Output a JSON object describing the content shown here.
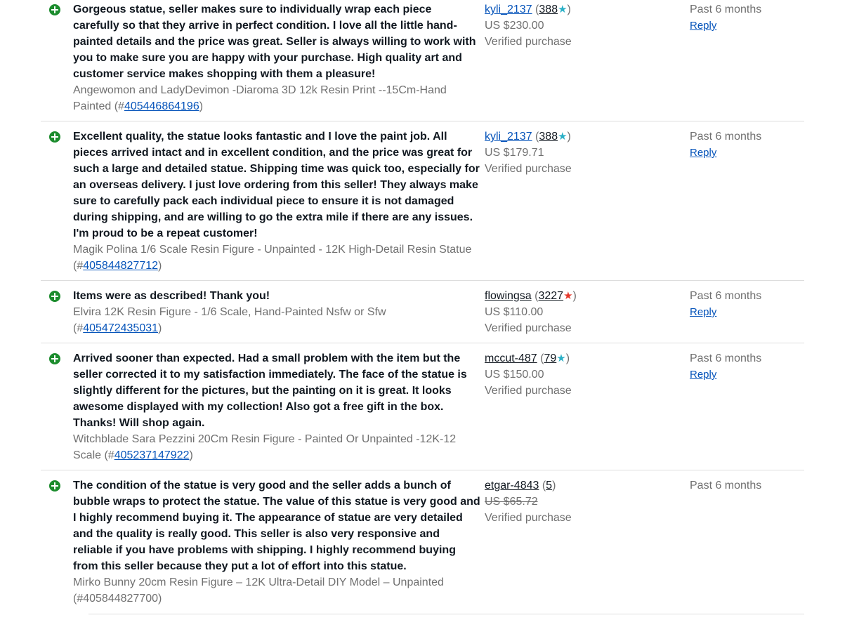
{
  "feedback": [
    {
      "comment": "Gorgeous statue, seller makes sure to individually wrap each piece carefully so that they arrive in perfect condition. I love all the little hand-painted details and the price was great. Seller is always willing to work with you to make sure you are happy with your purchase. High quality art and customer service makes shopping with them a pleasure!",
      "item_title": "Angewomon and LadyDevimon -Diaroma 3D 12k Resin Print --15Cm-Hand Painted",
      "item_id": "405446864196",
      "buyer": "kyli_2137",
      "score": "388",
      "star": "teal",
      "price": "US $230.00",
      "verified": "Verified purchase",
      "time": "Past 6 months",
      "reply": "Reply"
    },
    {
      "comment": "Excellent quality, the statue looks fantastic and I love the paint job. All pieces arrived intact and in excellent condition, and the price was great for such a large and detailed statue. Shipping time was quick too, especially for an overseas delivery. I just love ordering from this seller! They always make sure to carefully pack each individual piece to ensure it is not damaged during shipping, and are willing to go the extra mile if there are any issues. I'm proud to be a repeat customer!",
      "item_title": "Magik Polina 1/6 Scale Resin Figure - Unpainted - 12K High-Detail Resin Statue",
      "item_id": "405844827712",
      "buyer": "kyli_2137",
      "score": "388",
      "star": "teal",
      "price": "US $179.71",
      "verified": "Verified purchase",
      "time": "Past 6 months",
      "reply": "Reply"
    },
    {
      "comment": "Items were as described! Thank you!",
      "item_title": "Elvira 12K Resin Figure - 1/6 Scale, Hand-Painted Nsfw or Sfw",
      "item_id": "405472435031",
      "buyer": "flowingsa",
      "score": "3227",
      "star": "red",
      "price": "US $110.00",
      "verified": "Verified purchase",
      "time": "Past 6 months",
      "reply": "Reply"
    },
    {
      "comment": "Arrived sooner than expected. Had a small problem with the item but the seller corrected it to my satisfaction immediately. The face of the statue is slightly different for the pictures, but the painting on it is great. It looks awesome displayed with my collection! Also got a free gift in the box. Thanks! Will shop again.",
      "item_title": "Witchblade Sara Pezzini 20Cm Resin Figure - Painted Or Unpainted -12K-12 Scale",
      "item_id": "405237147922",
      "buyer": "mccut-487",
      "score": "79",
      "star": "teal",
      "price": "US $150.00",
      "verified": "Verified purchase",
      "time": "Past 6 months",
      "reply": "Reply"
    },
    {
      "comment": "The condition of the statue is very good and the seller adds a bunch of bubble wraps to protect the statue. The value of this statue is very good and I highly recommend buying it. The appearance of statue are very detailed and the quality is really good. This seller is also very responsive and reliable if you have problems with shipping. I highly recommend buying from this seller because they put a lot of effort into this statue.",
      "item_title": "Mirko Bunny 20cm Resin Figure – 12K Ultra-Detail DIY Model – Unpainted",
      "item_id": "405844827700",
      "buyer": "etgar-4843",
      "score": "5",
      "star": "",
      "price": "US $65.72",
      "verified": "Verified purchase",
      "time": "Past 6 months",
      "reply": ""
    }
  ],
  "colors": {
    "positive_icon": "#1b8c2d",
    "link": "#0654ba",
    "star_teal": "#2ab0c7",
    "star_red": "#e5382b",
    "muted_text": "#707070"
  }
}
